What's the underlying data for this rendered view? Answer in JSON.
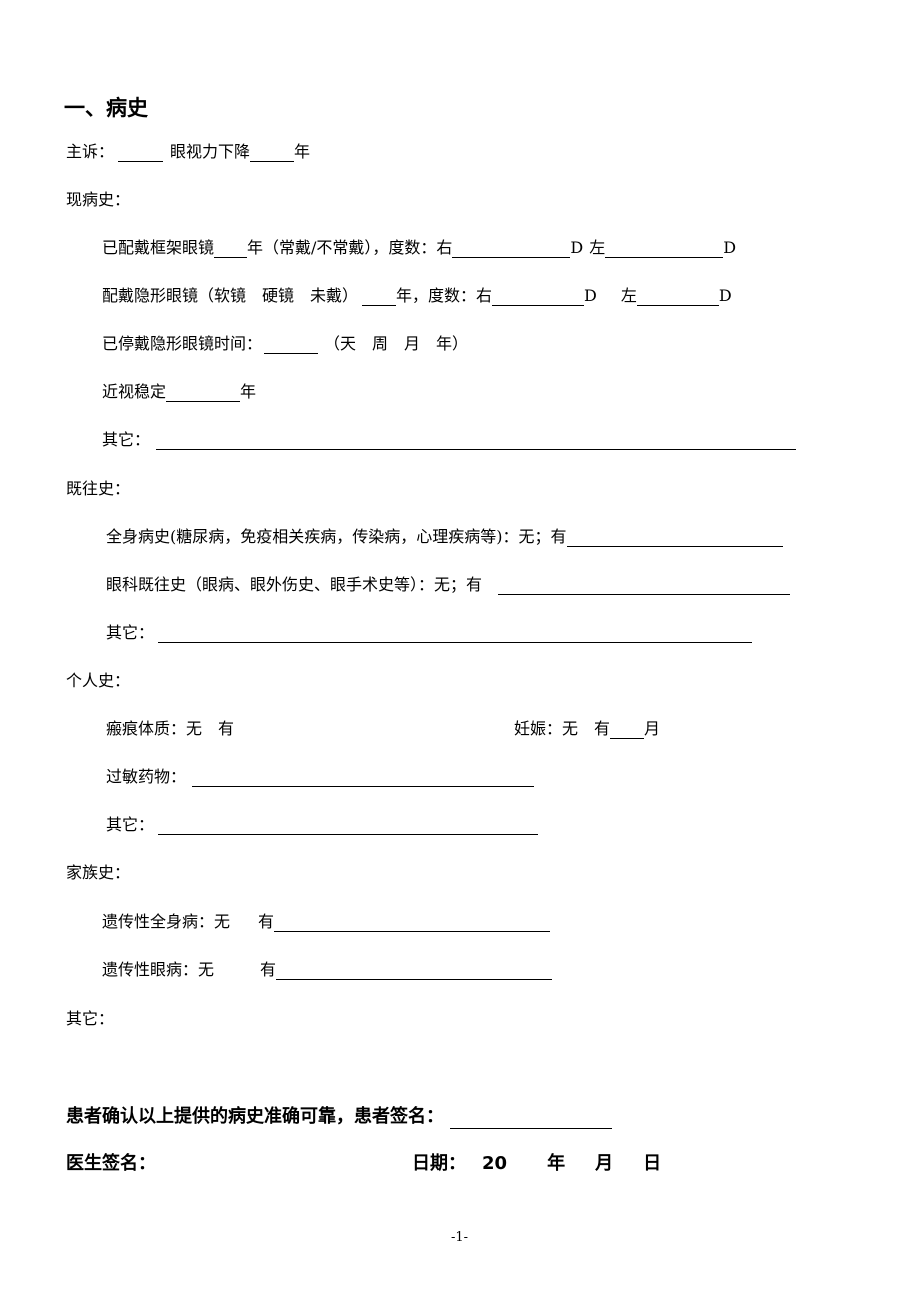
{
  "section_title": "一、病史",
  "chief_complaint": {
    "label": "主诉：",
    "mid": "眼视力下降",
    "unit": "年"
  },
  "present_history": {
    "label": "现病史：",
    "frame_glasses": {
      "prefix": "已配戴框架眼镜",
      "mid": "年（常戴/不常戴），度数：右",
      "d1": "D",
      "left": "左",
      "d2": "D"
    },
    "contact_lens": {
      "prefix": "配戴隐形眼镜（软镜　硬镜　未戴）",
      "mid": "年，度数：右",
      "d1": "D",
      "left": "左",
      "d2": "D"
    },
    "stopped": {
      "prefix": "已停戴隐形眼镜时间：",
      "units": "（天　周　月　年）"
    },
    "myopia_stable": {
      "prefix": "近视稳定",
      "unit": "年"
    },
    "other": {
      "label": "其它："
    }
  },
  "past_history": {
    "label": "既往史：",
    "systemic": {
      "text": "全身病史(糖尿病，免疫相关疾病，传染病，心理疾病等)：无；有"
    },
    "ocular": {
      "text": "眼科既往史（眼病、眼外伤史、眼手术史等）：无；有"
    },
    "other": {
      "label": "其它："
    }
  },
  "personal_history": {
    "label": "个人史：",
    "keloid": {
      "text": "瘢痕体质：无　有"
    },
    "pregnancy": {
      "prefix": "妊娠：无　有",
      "unit": "月"
    },
    "allergy": {
      "label": "过敏药物："
    },
    "other": {
      "label": "其它："
    }
  },
  "family_history": {
    "label": "家族史：",
    "hereditary_systemic": {
      "prefix": "遗传性全身病：无",
      "has": "有"
    },
    "hereditary_ocular": {
      "prefix": "遗传性眼病：无",
      "has": "有"
    }
  },
  "other": {
    "label": "其它："
  },
  "confirmation": {
    "text": "患者确认以上提供的病史准确可靠，患者签名："
  },
  "doctor_signature": {
    "label": "医生签名："
  },
  "date": {
    "label": "日期：",
    "year_prefix": "20",
    "year": "年",
    "month": "月",
    "day": "日"
  },
  "page_number": "-1-"
}
